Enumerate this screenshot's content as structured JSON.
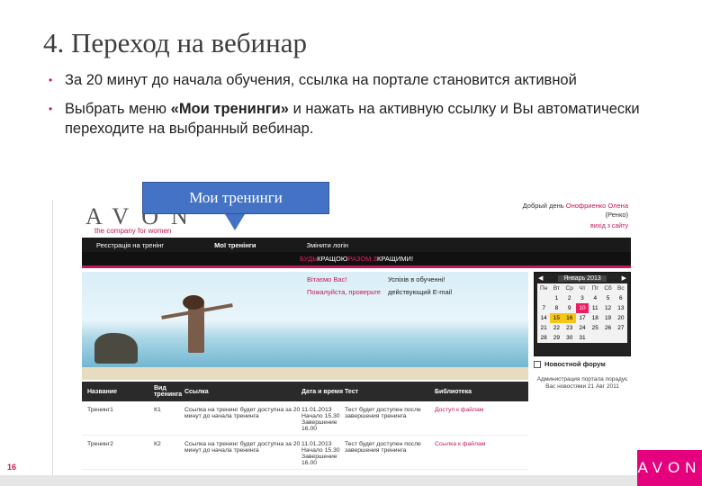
{
  "slide": {
    "title": "4. Переход на вебинар",
    "bullet1": "За 20 минут до начала обучения, ссылка на портале  становится активной",
    "bullet2_prefix": " Выбрать меню ",
    "bullet2_bold": "«Мои тренинги»",
    "bullet2_suffix": " и нажать на активную ссылку и Вы автоматически переходите на выбранный вебинар.",
    "page_number": "16"
  },
  "callout": {
    "label": "Мои тренинги"
  },
  "portal": {
    "logo": "AVON",
    "tagline": "the company for women",
    "greeting": "Добрый день",
    "user_name": "Онофриенко Олена",
    "user_extra": "(Ренко)",
    "exit": "вихід з сайту",
    "nav": {
      "item1": "Реєстрація на тренінг",
      "item2": "Мої тренінги",
      "item3": "Змінити логін"
    },
    "banner": {
      "p1": "БУДЬ ",
      "p2": "КРАЩОЮ ",
      "p3": "РАЗОМ З ",
      "p4": "КРАЩИМИ!"
    },
    "hero": {
      "line1a": "Вітаємо Вас!",
      "line1b": "Успіхів в обученні!",
      "line2a": "Пожалуйста, проверьте",
      "line2b": "действующий E-mail"
    },
    "calendar": {
      "month": "Январь 2013",
      "days_header": [
        "Пн",
        "Вт",
        "Ср",
        "Чт",
        "Пт",
        "Сб",
        "Вс"
      ],
      "days": [
        "",
        "1",
        "2",
        "3",
        "4",
        "5",
        "6",
        "7",
        "8",
        "9",
        "10",
        "11",
        "12",
        "13",
        "14",
        "15",
        "16",
        "17",
        "18",
        "19",
        "20",
        "21",
        "22",
        "23",
        "24",
        "25",
        "26",
        "27",
        "28",
        "29",
        "30",
        "31",
        "",
        "",
        ""
      ]
    },
    "forum": {
      "label": "Новостной форум",
      "text": "Администрация портала порадує Вас новостями 21 Авг 2011"
    },
    "table": {
      "headers": [
        "Название",
        "Вид тренинга",
        "Ссылка",
        "Дата и время",
        "Тест",
        "Библиотека"
      ],
      "rows": [
        {
          "name": "Тренинг1",
          "type": "К1",
          "link": "Ссылка на тренинг будет доступна за 20 минут до начала тренинга",
          "date": "11.01.2013 Начало 15.30 Завершение 16.00",
          "test": "Тест будет доступен после завершения тренинга",
          "lib": "Доступ к файлам"
        },
        {
          "name": "Тренинг2",
          "type": "К2",
          "link": "Ссылка на тренинг будет доступна за 20 минут до начала тренинга",
          "date": "11.01.2013 Начало 15.30 Завершение 16.00",
          "test": "Тест будет доступен после завершения тренинга",
          "lib": "Ссылка к файлам"
        }
      ]
    }
  },
  "footer": {
    "logo": "AVON"
  }
}
